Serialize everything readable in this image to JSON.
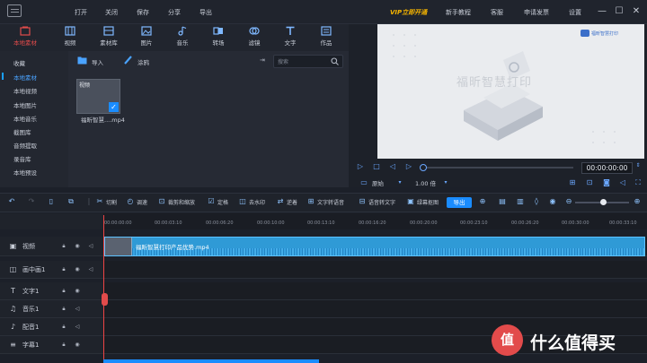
{
  "titlebar": {
    "menu": [
      "打开",
      "关闭",
      "保存",
      "分享",
      "导出"
    ],
    "vip": "VIP立即开通",
    "right_menu": [
      "新手教程",
      "客服",
      "申请发票",
      "设置"
    ],
    "win": {
      "minimize": "—",
      "maximize": "☐",
      "close": "✕"
    }
  },
  "toolbar": {
    "tabs": [
      "本地素材",
      "视频",
      "素材库",
      "图片",
      "音乐",
      "转场",
      "滤镜",
      "文字",
      "作品"
    ]
  },
  "sidebar": {
    "items": [
      "收藏",
      "本地素材",
      "本地视频",
      "本地图片",
      "本地音乐",
      "截图库",
      "音频提取",
      "录音库",
      "本地预设"
    ]
  },
  "media": {
    "import_label": "导入",
    "draw_label": "涂鸦",
    "search_placeholder": "搜索",
    "thumb_tag": "视频",
    "thumb_file": "福昕智慧....mp4"
  },
  "preview": {
    "logo_text": "福昕智慧打印",
    "watermark": "福昕智慧打印",
    "timecode": "00:00:00:00",
    "ratio_label": "原始",
    "speed_label": "1.00 倍"
  },
  "edit_toolbar": {
    "items": [
      "切割",
      "调速",
      "裁剪和缩放",
      "定格",
      "去水印",
      "逆着",
      "文字转语音",
      "语音转文字",
      "绿幕抠图"
    ],
    "export_label": "导出"
  },
  "ruler": {
    "labels": [
      "00:00:00:00",
      "00:00:03:10",
      "00:00:06:20",
      "00:00:10:00",
      "00:00:13:10",
      "00:00:16:20",
      "00:00:20:00",
      "00:00:23:10",
      "00:00:26:20",
      "00:00:30:00",
      "00:00:33:10"
    ]
  },
  "tracks": [
    {
      "name": "视频",
      "icon": "video-track-icon"
    },
    {
      "name": "画中画1",
      "icon": "pip-track-icon"
    },
    {
      "name": "文字1",
      "icon": "text-track-icon"
    },
    {
      "name": "音乐1",
      "icon": "music-track-icon"
    },
    {
      "name": "配音1",
      "icon": "voice-track-icon"
    },
    {
      "name": "字幕1",
      "icon": "subtitle-track-icon"
    }
  ],
  "clip": {
    "name": "福昕智慧打印产品优势.mp4"
  },
  "watermark": {
    "badge": "值",
    "text": "什么值得买"
  }
}
